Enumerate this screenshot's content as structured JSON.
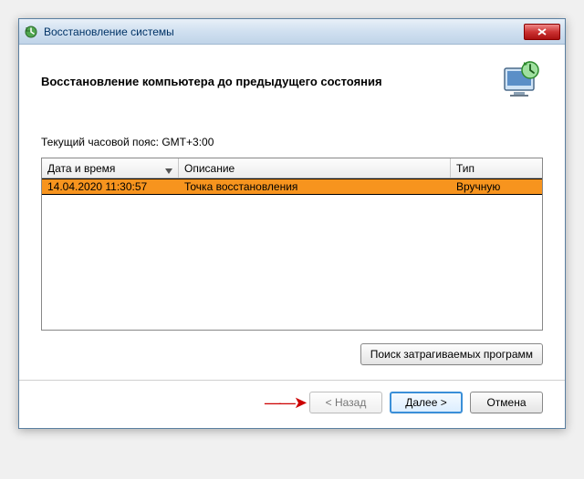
{
  "window": {
    "title": "Восстановление системы"
  },
  "header": {
    "heading": "Восстановление компьютера до предыдущего состояния"
  },
  "timezone": "Текущий часовой пояс: GMT+3:00",
  "table": {
    "columns": {
      "datetime": "Дата и время",
      "description": "Описание",
      "type": "Тип"
    },
    "rows": [
      {
        "datetime": "14.04.2020 11:30:57",
        "description": "Точка восстановления",
        "type": "Вручную"
      }
    ]
  },
  "buttons": {
    "scan": "Поиск затрагиваемых программ",
    "back": "< Назад",
    "next": "Далее >",
    "cancel": "Отмена"
  }
}
